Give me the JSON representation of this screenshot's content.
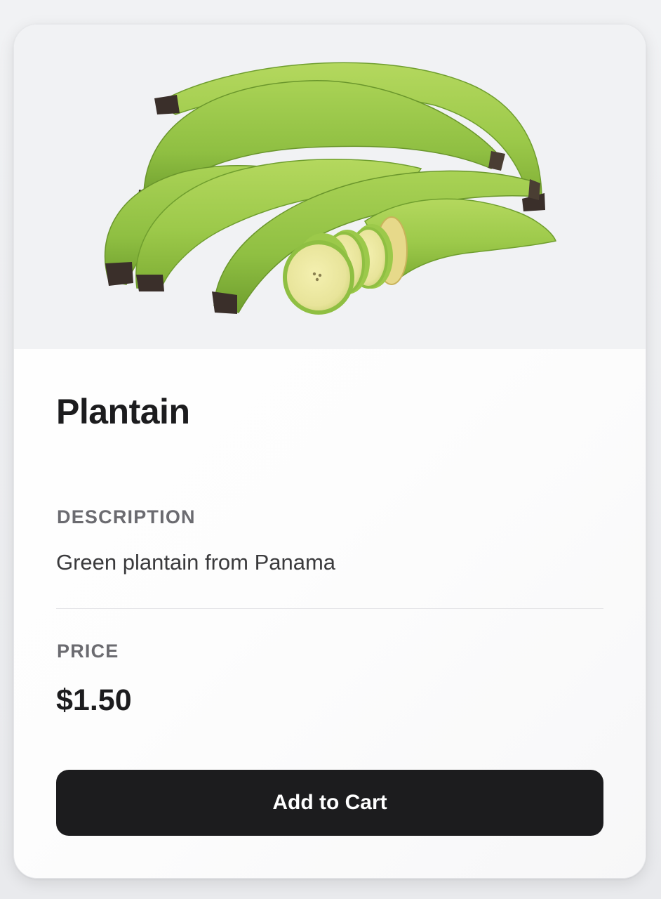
{
  "product": {
    "image_alt": "plantain-bunch",
    "name": "Plantain",
    "description_label": "DESCRIPTION",
    "description": "Green plantain from Panama",
    "price_label": "PRICE",
    "price": "$1.50"
  },
  "actions": {
    "add_to_cart_label": "Add to Cart"
  },
  "colors": {
    "button_bg": "#1c1c1e",
    "button_text": "#ffffff",
    "image_bg": "#f1f2f4",
    "plantain_green": "#9cc94a"
  }
}
